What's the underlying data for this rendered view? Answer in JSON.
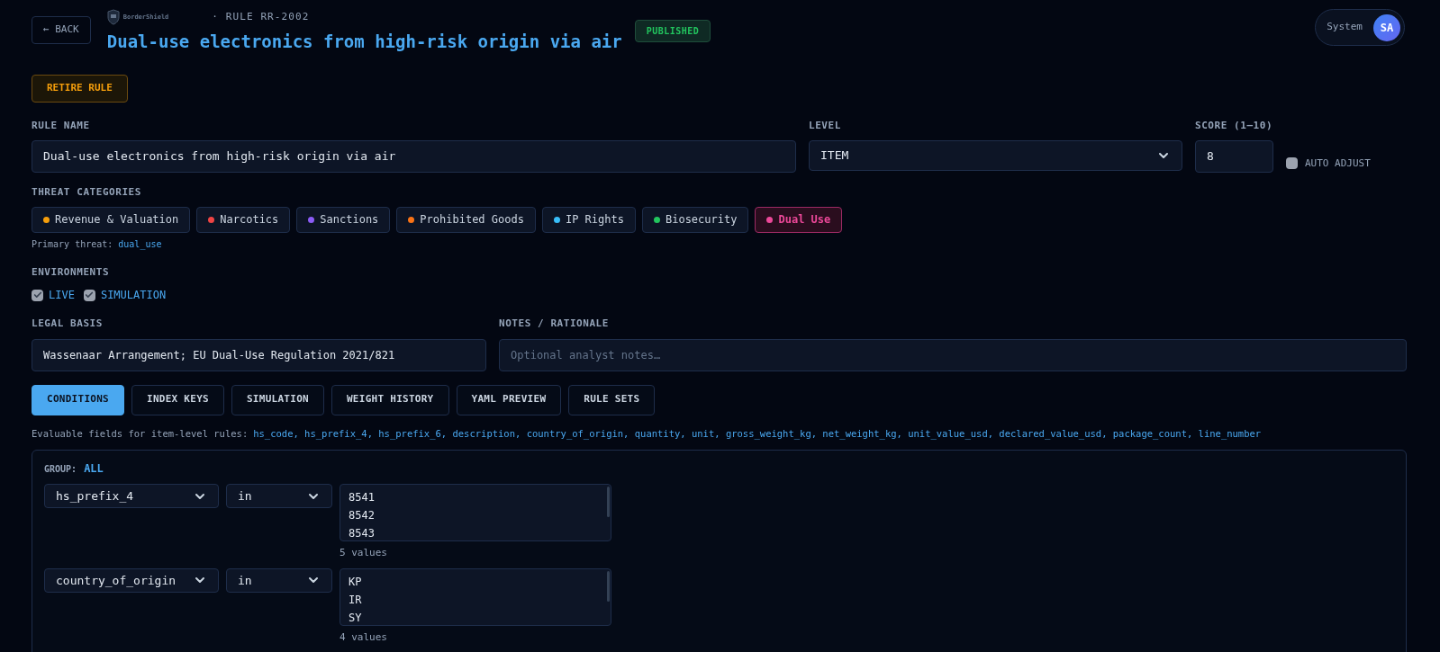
{
  "header": {
    "back": "← BACK",
    "brand": "BorderShield",
    "rule_id": "· RULE RR-2002",
    "title": "Dual-use electronics from high-risk origin via air",
    "status": "PUBLISHED",
    "user": {
      "name": "System",
      "initials": "SA"
    }
  },
  "actions": {
    "retire": "RETIRE RULE"
  },
  "form": {
    "rule_name": {
      "label": "RULE NAME",
      "value": "Dual-use electronics from high-risk origin via air"
    },
    "level": {
      "label": "LEVEL",
      "value": "ITEM"
    },
    "score": {
      "label": "SCORE (1–10)",
      "value": "8"
    },
    "auto_adjust": {
      "label": "AUTO ADJUST",
      "checked": false
    },
    "threat_categories": {
      "label": "THREAT CATEGORIES",
      "items": [
        {
          "label": "Revenue & Valuation",
          "color": "#f59e0b",
          "selected": false
        },
        {
          "label": "Narcotics",
          "color": "#ef4444",
          "selected": false
        },
        {
          "label": "Sanctions",
          "color": "#8b5cf6",
          "selected": false
        },
        {
          "label": "Prohibited Goods",
          "color": "#f97316",
          "selected": false
        },
        {
          "label": "IP Rights",
          "color": "#38bdf8",
          "selected": false
        },
        {
          "label": "Biosecurity",
          "color": "#22c55e",
          "selected": false
        },
        {
          "label": "Dual Use",
          "color": "#ec4899",
          "selected": true
        }
      ],
      "primary_label": "Primary threat:",
      "primary_value": "dual_use"
    },
    "environments": {
      "label": "ENVIRONMENTS",
      "items": [
        {
          "label": "LIVE",
          "checked": true
        },
        {
          "label": "SIMULATION",
          "checked": true
        }
      ]
    },
    "legal_basis": {
      "label": "LEGAL BASIS",
      "value": "Wassenaar Arrangement; EU Dual-Use Regulation 2021/821"
    },
    "notes": {
      "label": "NOTES / RATIONALE",
      "placeholder": "Optional analyst notes…"
    }
  },
  "tabs": [
    {
      "label": "CONDITIONS",
      "selected": true
    },
    {
      "label": "INDEX KEYS",
      "selected": false
    },
    {
      "label": "SIMULATION",
      "selected": false
    },
    {
      "label": "WEIGHT HISTORY",
      "selected": false
    },
    {
      "label": "YAML PREVIEW",
      "selected": false
    },
    {
      "label": "RULE SETS",
      "selected": false
    }
  ],
  "evaluable": {
    "label": "Evaluable fields for item-level rules:",
    "fields": "hs_code, hs_prefix_4, hs_prefix_6, description, country_of_origin, quantity, unit, gross_weight_kg, net_weight_kg, unit_value_usd, declared_value_usd, package_count, line_number"
  },
  "group": {
    "label": "GROUP:",
    "value": "ALL",
    "conditions": [
      {
        "field": "hs_prefix_4",
        "operator": "in",
        "values": [
          "8541",
          "8542",
          "8543"
        ],
        "count": "5 values"
      },
      {
        "field": "country_of_origin",
        "operator": "in",
        "values": [
          "KP",
          "IR",
          "SY"
        ],
        "count": "4 values"
      }
    ]
  }
}
